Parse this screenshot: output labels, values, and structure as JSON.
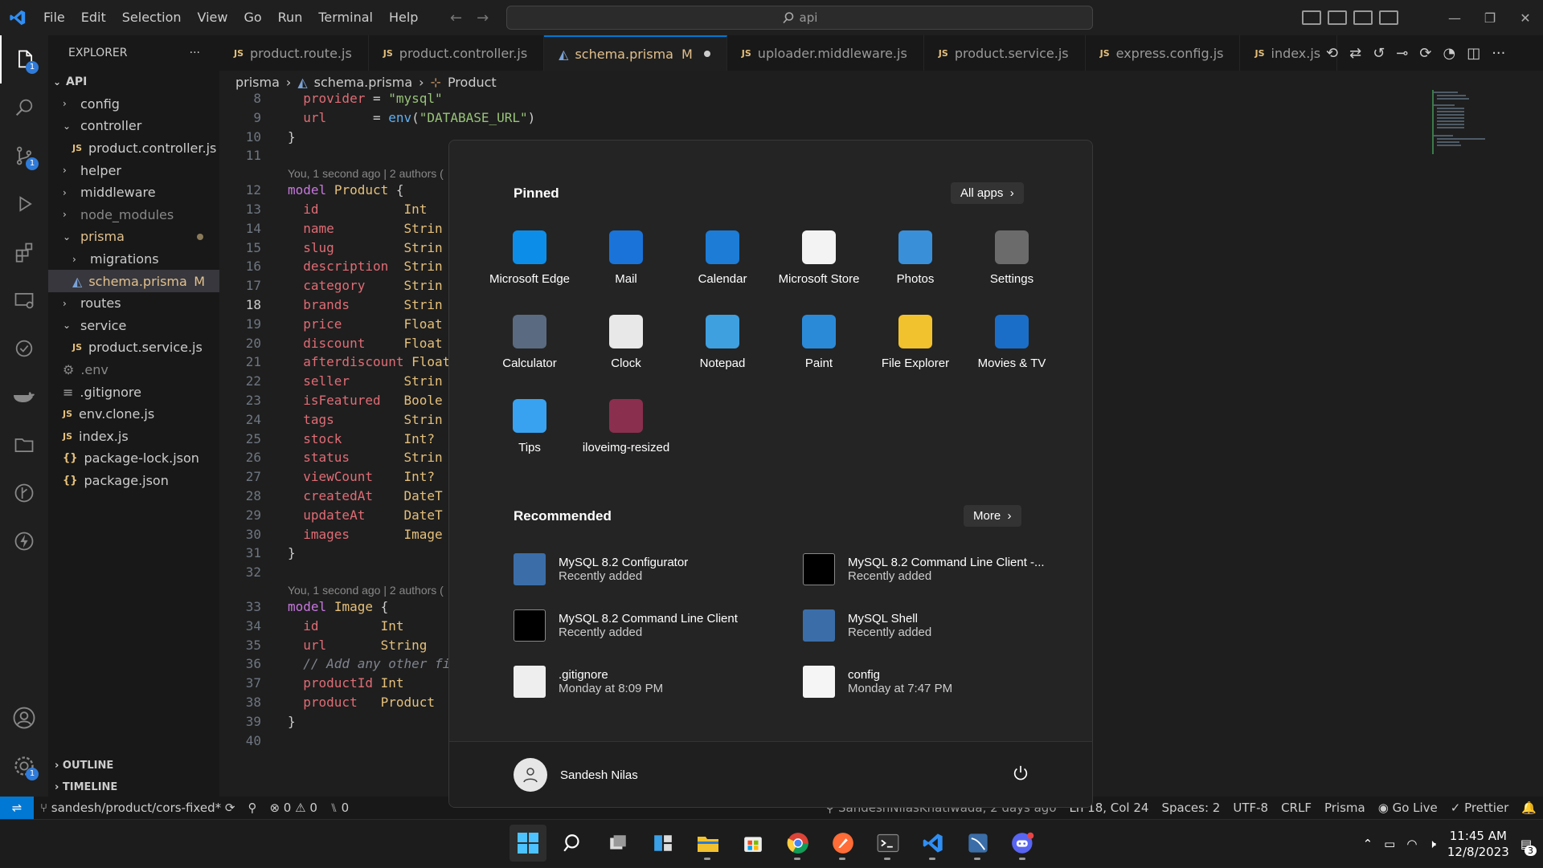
{
  "menu": [
    "File",
    "Edit",
    "Selection",
    "View",
    "Go",
    "Run",
    "Terminal",
    "Help"
  ],
  "search": {
    "placeholder": "api"
  },
  "explorer": {
    "title": "EXPLORER",
    "root": "API",
    "items": [
      {
        "label": "config",
        "type": "folder",
        "open": false,
        "indent": 1
      },
      {
        "label": "controller",
        "type": "folder",
        "open": true,
        "indent": 1
      },
      {
        "label": "product.controller.js",
        "type": "js",
        "indent": 2
      },
      {
        "label": "helper",
        "type": "folder",
        "open": false,
        "indent": 1
      },
      {
        "label": "middleware",
        "type": "folder",
        "open": false,
        "indent": 1
      },
      {
        "label": "node_modules",
        "type": "folder",
        "open": false,
        "indent": 1,
        "dim": true
      },
      {
        "label": "prisma",
        "type": "folder",
        "open": true,
        "indent": 1,
        "dot": true
      },
      {
        "label": "migrations",
        "type": "folder",
        "open": false,
        "indent": 2
      },
      {
        "label": "schema.prisma",
        "type": "prisma",
        "indent": 2,
        "selected": true,
        "badge": "M"
      },
      {
        "label": "routes",
        "type": "folder",
        "open": false,
        "indent": 1
      },
      {
        "label": "service",
        "type": "folder",
        "open": true,
        "indent": 1
      },
      {
        "label": "product.service.js",
        "type": "js",
        "indent": 2
      },
      {
        "label": ".env",
        "type": "env",
        "indent": 1,
        "dim": true
      },
      {
        "label": ".gitignore",
        "type": "git",
        "indent": 1
      },
      {
        "label": "env.clone.js",
        "type": "js",
        "indent": 1
      },
      {
        "label": "index.js",
        "type": "js",
        "indent": 1
      },
      {
        "label": "package-lock.json",
        "type": "json",
        "indent": 1
      },
      {
        "label": "package.json",
        "type": "json",
        "indent": 1
      }
    ],
    "outline": "OUTLINE",
    "timeline": "TIMELINE"
  },
  "tabs": [
    {
      "label": "product.route.js",
      "icon": "JS"
    },
    {
      "label": "product.controller.js",
      "icon": "JS"
    },
    {
      "label": "schema.prisma",
      "icon": "prisma",
      "active": true,
      "mod": "M"
    },
    {
      "label": "uploader.middleware.js",
      "icon": "JS"
    },
    {
      "label": "product.service.js",
      "icon": "JS"
    },
    {
      "label": "express.config.js",
      "icon": "JS"
    },
    {
      "label": "index.js",
      "icon": "JS"
    }
  ],
  "breadcrumb": [
    "prisma",
    "schema.prisma",
    "Product"
  ],
  "code": {
    "blame1": "You, 1 second ago | 2 authors (",
    "blame2": "You, 1 second ago | 2 authors (",
    "lines": [
      {
        "n": "8",
        "t": [
          [
            "fd",
            "  provider"
          ],
          [
            "",
            "",
            " = "
          ],
          [
            "st",
            "\"mysql\""
          ]
        ]
      },
      {
        "n": "9",
        "t": [
          [
            "fd",
            "  url"
          ],
          [
            "",
            "      = "
          ],
          [
            "fn",
            "env"
          ],
          [
            "",
            "("
          ],
          [
            "st",
            "\"DATABASE_URL\""
          ],
          [
            "",
            ")"
          ]
        ]
      },
      {
        "n": "10",
        "t": [
          [
            "",
            "}"
          ]
        ]
      },
      {
        "n": "11",
        "t": []
      },
      {
        "n": "12",
        "t": [
          [
            "kw",
            "model"
          ],
          [
            "",
            " "
          ],
          [
            "ty",
            "Product"
          ],
          [
            "",
            " {"
          ]
        ]
      },
      {
        "n": "13",
        "t": [
          [
            "fd",
            "  id"
          ],
          [
            "",
            "           "
          ],
          [
            "ty",
            "Int"
          ]
        ]
      },
      {
        "n": "14",
        "t": [
          [
            "fd",
            "  name"
          ],
          [
            "",
            "         "
          ],
          [
            "ty",
            "Strin"
          ]
        ]
      },
      {
        "n": "15",
        "t": [
          [
            "fd",
            "  slug"
          ],
          [
            "",
            "         "
          ],
          [
            "ty",
            "Strin"
          ]
        ]
      },
      {
        "n": "16",
        "t": [
          [
            "fd",
            "  description"
          ],
          [
            "",
            "  "
          ],
          [
            "ty",
            "Strin"
          ]
        ]
      },
      {
        "n": "17",
        "t": [
          [
            "fd",
            "  category"
          ],
          [
            "",
            "     "
          ],
          [
            "ty",
            "Strin"
          ]
        ]
      },
      {
        "n": "18",
        "t": [
          [
            "fd",
            "  brands"
          ],
          [
            "",
            "       "
          ],
          [
            "ty",
            "Strin"
          ]
        ]
      },
      {
        "n": "19",
        "t": [
          [
            "fd",
            "  price"
          ],
          [
            "",
            "        "
          ],
          [
            "ty",
            "Float"
          ]
        ]
      },
      {
        "n": "20",
        "t": [
          [
            "fd",
            "  discount"
          ],
          [
            "",
            "     "
          ],
          [
            "ty",
            "Float"
          ]
        ]
      },
      {
        "n": "21",
        "t": [
          [
            "fd",
            "  afterdiscount"
          ],
          [
            "",
            " "
          ],
          [
            "ty",
            "Float"
          ]
        ]
      },
      {
        "n": "22",
        "t": [
          [
            "fd",
            "  seller"
          ],
          [
            "",
            "       "
          ],
          [
            "ty",
            "Strin"
          ]
        ]
      },
      {
        "n": "23",
        "t": [
          [
            "fd",
            "  isFeatured"
          ],
          [
            "",
            "   "
          ],
          [
            "ty",
            "Boole"
          ]
        ]
      },
      {
        "n": "24",
        "t": [
          [
            "fd",
            "  tags"
          ],
          [
            "",
            "         "
          ],
          [
            "ty",
            "Strin"
          ]
        ]
      },
      {
        "n": "25",
        "t": [
          [
            "fd",
            "  stock"
          ],
          [
            "",
            "        "
          ],
          [
            "ty",
            "Int?"
          ]
        ]
      },
      {
        "n": "26",
        "t": [
          [
            "fd",
            "  status"
          ],
          [
            "",
            "       "
          ],
          [
            "ty",
            "Strin"
          ]
        ]
      },
      {
        "n": "27",
        "t": [
          [
            "fd",
            "  viewCount"
          ],
          [
            "",
            "    "
          ],
          [
            "ty",
            "Int?"
          ]
        ]
      },
      {
        "n": "28",
        "t": [
          [
            "fd",
            "  createdAt"
          ],
          [
            "",
            "    "
          ],
          [
            "ty",
            "DateT"
          ]
        ]
      },
      {
        "n": "29",
        "t": [
          [
            "fd",
            "  updateAt"
          ],
          [
            "",
            "     "
          ],
          [
            "ty",
            "DateT"
          ]
        ]
      },
      {
        "n": "30",
        "t": [
          [
            "fd",
            "  images"
          ],
          [
            "",
            "       "
          ],
          [
            "ty",
            "Image"
          ]
        ]
      },
      {
        "n": "31",
        "t": [
          [
            "",
            "}"
          ]
        ]
      },
      {
        "n": "32",
        "t": []
      },
      {
        "n": "33",
        "t": [
          [
            "kw",
            "model"
          ],
          [
            "",
            " "
          ],
          [
            "ty",
            "Image"
          ],
          [
            "",
            " {"
          ]
        ]
      },
      {
        "n": "34",
        "t": [
          [
            "fd",
            "  id"
          ],
          [
            "",
            "        "
          ],
          [
            "ty",
            "Int"
          ]
        ]
      },
      {
        "n": "35",
        "t": [
          [
            "fd",
            "  url"
          ],
          [
            "",
            "       "
          ],
          [
            "ty",
            "String"
          ]
        ]
      },
      {
        "n": "36",
        "t": [
          [
            "cm",
            "  // Add any other fi"
          ]
        ]
      },
      {
        "n": "37",
        "t": [
          [
            "fd",
            "  productId"
          ],
          [
            "",
            " "
          ],
          [
            "ty",
            "Int"
          ]
        ]
      },
      {
        "n": "38",
        "t": [
          [
            "fd",
            "  product"
          ],
          [
            "",
            "   "
          ],
          [
            "ty",
            "Product"
          ]
        ]
      },
      {
        "n": "39",
        "t": [
          [
            "",
            "}"
          ]
        ]
      },
      {
        "n": "40",
        "t": []
      }
    ]
  },
  "status": {
    "branch": "sandesh/product/cors-fixed*",
    "errors": "0",
    "warnings": "0",
    "ports": "0",
    "blame": "SandeshNilasKhatiwada, 2 days ago",
    "position": "Ln 18, Col 24",
    "spaces": "Spaces: 2",
    "encoding": "UTF-8",
    "eol": "CRLF",
    "lang": "Prisma",
    "golive": "Go Live",
    "prettier": "Prettier"
  },
  "start": {
    "pinned_title": "Pinned",
    "all_apps": "All apps",
    "apps": [
      {
        "label": "Microsoft Edge",
        "icon": "edge-icon",
        "color": "#0c8ee8"
      },
      {
        "label": "Mail",
        "icon": "mail-icon",
        "color": "#1a73d8"
      },
      {
        "label": "Calendar",
        "icon": "calendar-icon",
        "color": "#1c7cd6"
      },
      {
        "label": "Microsoft Store",
        "icon": "store-icon",
        "color": "#f3f3f3"
      },
      {
        "label": "Photos",
        "icon": "photos-icon",
        "color": "#3a8fd9"
      },
      {
        "label": "Settings",
        "icon": "settings-icon",
        "color": "#6b6b6b"
      },
      {
        "label": "Calculator",
        "icon": "calculator-icon",
        "color": "#5a6a80"
      },
      {
        "label": "Clock",
        "icon": "clock-icon",
        "color": "#e8e8e8"
      },
      {
        "label": "Notepad",
        "icon": "notepad-icon",
        "color": "#3fa0e0"
      },
      {
        "label": "Paint",
        "icon": "paint-icon",
        "color": "#2b8ad8"
      },
      {
        "label": "File Explorer",
        "icon": "folder-icon",
        "color": "#f2c12e"
      },
      {
        "label": "Movies & TV",
        "icon": "movies-icon",
        "color": "#1b6ec8"
      },
      {
        "label": "Tips",
        "icon": "tips-icon",
        "color": "#39a2f0"
      },
      {
        "label": "iloveimg-resized",
        "icon": "archive-icon",
        "color": "#8b2f4f"
      }
    ],
    "recommended_title": "Recommended",
    "more": "More",
    "recommended": [
      {
        "title": "MySQL 8.2 Configurator",
        "sub": "Recently added",
        "icon": "mysql-icon"
      },
      {
        "title": "MySQL 8.2 Command Line Client -...",
        "sub": "Recently added",
        "icon": "mysql-cli-icon"
      },
      {
        "title": "MySQL 8.2 Command Line Client",
        "sub": "Recently added",
        "icon": "mysql-cli-icon"
      },
      {
        "title": "MySQL Shell",
        "sub": "Recently added",
        "icon": "mysql-icon"
      },
      {
        "title": ".gitignore",
        "sub": "Monday at 8:09 PM",
        "icon": "gear-file-icon"
      },
      {
        "title": "config",
        "sub": "Monday at 7:47 PM",
        "icon": "file-icon"
      }
    ],
    "user": "Sandesh Nilas"
  },
  "taskbar": {
    "time": "11:45 AM",
    "date": "12/8/2023",
    "notifications": "3"
  }
}
